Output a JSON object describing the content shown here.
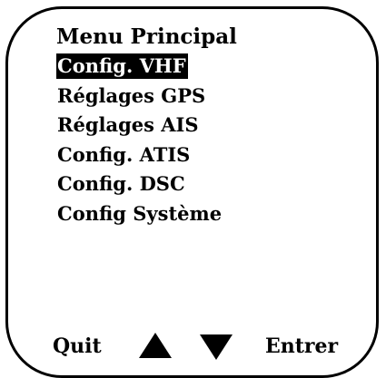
{
  "menu": {
    "title": "Menu Principal",
    "items": [
      {
        "label": "Config. VHF",
        "selected": true
      },
      {
        "label": "Réglages GPS",
        "selected": false
      },
      {
        "label": "Réglages AIS",
        "selected": false
      },
      {
        "label": "Config. ATIS",
        "selected": false
      },
      {
        "label": "Config. DSC",
        "selected": false
      },
      {
        "label": "Config Système",
        "selected": false
      }
    ]
  },
  "softkeys": {
    "left_label": "Quit",
    "up_icon": "arrow-up-icon",
    "down_icon": "arrow-down-icon",
    "right_label": "Entrer"
  }
}
